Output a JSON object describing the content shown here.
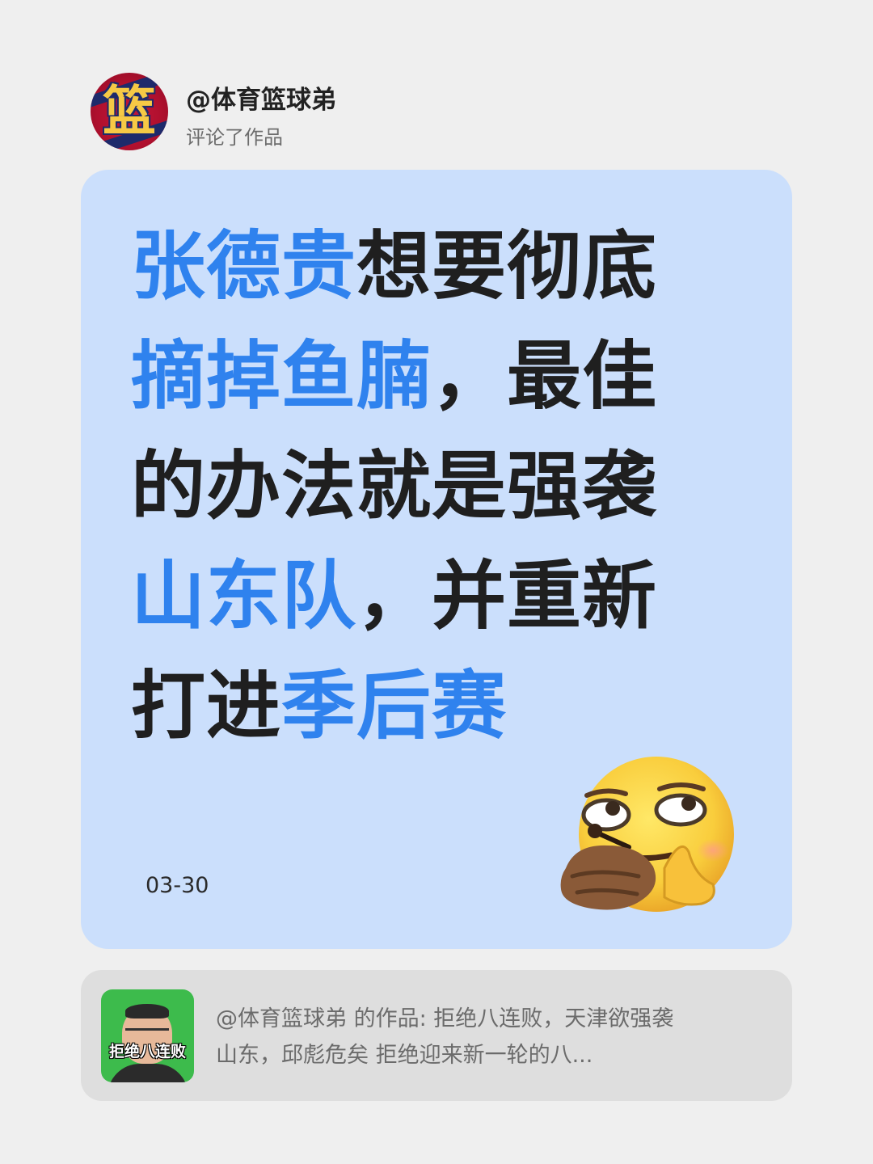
{
  "header": {
    "username": "@体育篮球弟",
    "action": "评论了作品",
    "avatar_glyph": "篮"
  },
  "card": {
    "headline_lines": [
      [
        {
          "text": "张德贵",
          "highlight": true
        },
        {
          "text": "想要彻底",
          "highlight": false
        }
      ],
      [
        {
          "text": "摘掉鱼腩",
          "highlight": true
        },
        {
          "text": "，最佳",
          "highlight": false
        }
      ],
      [
        {
          "text": "的办法就是强袭",
          "highlight": false
        }
      ],
      [
        {
          "text": "山东队",
          "highlight": true
        },
        {
          "text": "，并重新",
          "highlight": false
        }
      ],
      [
        {
          "text": "打进",
          "highlight": false
        },
        {
          "text": "季后赛",
          "highlight": true
        }
      ]
    ],
    "date": "03-30",
    "emoji": "smirking-thinking-face-emoji",
    "colors": {
      "card_bg": "#cbdffc",
      "highlight": "#2f82ee",
      "text": "#1f1f1f"
    }
  },
  "reference": {
    "thumbnail_label": "拒绝八连败",
    "line1": "@体育篮球弟 的作品: 拒绝八连败，天津欲强袭",
    "line2": "山东，邱彪危矣 拒绝迎来新一轮的八..."
  }
}
